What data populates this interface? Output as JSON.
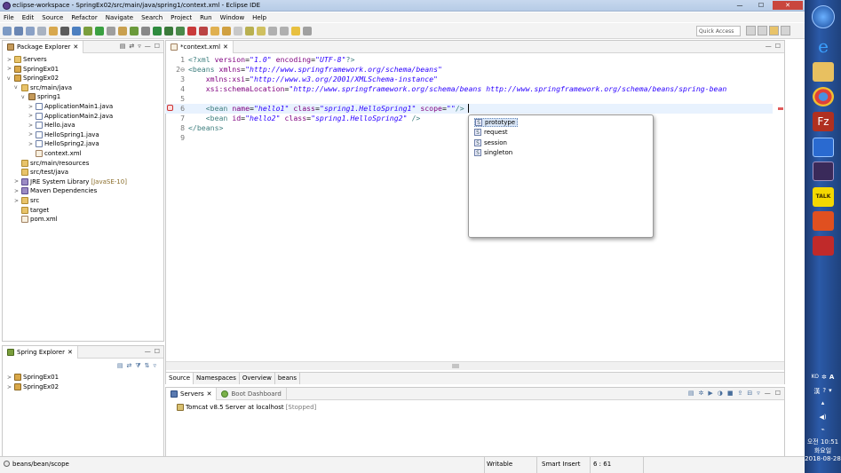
{
  "window": {
    "title": "eclipse-workspace - SpringEx02/src/main/java/spring1/context.xml - Eclipse IDE"
  },
  "menu": [
    "File",
    "Edit",
    "Source",
    "Refactor",
    "Navigate",
    "Search",
    "Project",
    "Run",
    "Window",
    "Help"
  ],
  "toolbar": {
    "quick_access": "Quick Access"
  },
  "package_explorer": {
    "title": "Package Explorer",
    "items": [
      {
        "label": "Servers",
        "icon": "folder",
        "arrow": ">"
      },
      {
        "label": "SpringEx01",
        "icon": "proj",
        "arrow": ">"
      },
      {
        "label": "SpringEx02",
        "icon": "proj",
        "arrow": "v"
      },
      {
        "label": "src/main/java",
        "icon": "folder",
        "arrow": "v"
      },
      {
        "label": "spring1",
        "icon": "pkg",
        "arrow": "v"
      },
      {
        "label": "ApplicationMain1.java",
        "icon": "jfile",
        "arrow": ">"
      },
      {
        "label": "ApplicationMain2.java",
        "icon": "jfile",
        "arrow": ">"
      },
      {
        "label": "Hello.java",
        "icon": "jfile",
        "arrow": ">"
      },
      {
        "label": "HelloSpring1.java",
        "icon": "jfile",
        "arrow": ">"
      },
      {
        "label": "HelloSpring2.java",
        "icon": "jfile",
        "arrow": ">"
      },
      {
        "label": "context.xml",
        "icon": "xfile",
        "arrow": ""
      },
      {
        "label": "src/main/resources",
        "icon": "folder",
        "arrow": ""
      },
      {
        "label": "src/test/java",
        "icon": "folder",
        "arrow": ""
      },
      {
        "label": "JRE System Library",
        "note": "[JavaSE-10]",
        "icon": "lib",
        "arrow": ">"
      },
      {
        "label": "Maven Dependencies",
        "icon": "lib",
        "arrow": ">"
      },
      {
        "label": "src",
        "icon": "folder",
        "arrow": ">"
      },
      {
        "label": "target",
        "icon": "folder",
        "arrow": ""
      },
      {
        "label": "pom.xml",
        "icon": "xfile",
        "arrow": ""
      }
    ]
  },
  "spring_explorer": {
    "title": "Spring Explorer",
    "items": [
      {
        "label": "SpringEx01"
      },
      {
        "label": "SpringEx02"
      }
    ]
  },
  "editor": {
    "tab_label": "*context.xml",
    "lines": [
      {
        "n": "1",
        "html": "<span class=\"pi\">&lt;?xml</span> <span class=\"attr\">version</span>=<span class=\"val\">\"1.0\"</span> <span class=\"attr\">encoding</span>=<span class=\"val\">\"UTF-8\"</span><span class=\"pi\">?&gt;</span>"
      },
      {
        "n": "2⊖",
        "html": "<span class=\"tag\">&lt;beans</span> <span class=\"attr\">xmlns</span>=<span class=\"val\">\"http://www.springframework.org/schema/beans\"</span>"
      },
      {
        "n": "3",
        "html": "    <span class=\"attr\">xmlns:xsi</span>=<span class=\"val\">\"http://www.w3.org/2001/XMLSchema-instance\"</span>"
      },
      {
        "n": "4",
        "html": "    <span class=\"attr\">xsi:schemaLocation</span>=<span class=\"val\">\"http://www.springframework.org/schema/beans http://www.springframework.org/schema/beans/spring-bean</span>"
      },
      {
        "n": "5",
        "html": ""
      },
      {
        "n": "6",
        "html": "    <span class=\"tag\">&lt;bean</span> <span class=\"attr\">name</span>=<span class=\"val\">\"hello1\"</span> <span class=\"attr\">class</span>=<span class=\"val\">\"spring1.HelloSpring1\"</span> <span class=\"attr\">scope</span>=<span class=\"val\">\"\"</span><span class=\"tag\">/&gt;</span>"
      },
      {
        "n": "7",
        "html": "    <span class=\"tag\">&lt;bean</span> <span class=\"attr\">id</span>=<span class=\"val\">\"hello2\"</span> <span class=\"attr\">class</span>=<span class=\"val\">\"spring1.HelloSpring2\"</span> <span class=\"tag\">/&gt;</span>"
      },
      {
        "n": "8",
        "html": "<span class=\"tag\">&lt;/beans&gt;</span>"
      },
      {
        "n": "9",
        "html": ""
      }
    ],
    "bottom_tabs": [
      "Source",
      "Namespaces",
      "Overview",
      "beans"
    ]
  },
  "autocomplete": {
    "items": [
      {
        "label": "prototype",
        "selected": true
      },
      {
        "label": "request",
        "selected": false
      },
      {
        "label": "session",
        "selected": false
      },
      {
        "label": "singleton",
        "selected": false
      }
    ]
  },
  "servers_panel": {
    "tabs": [
      "Servers",
      "Boot Dashboard"
    ],
    "server": "Tomcat v8.5 Server at localhost",
    "status": "[Stopped]"
  },
  "status_bar": {
    "path": "beans/bean/scope",
    "writable": "Writable",
    "insert_mode": "Smart Insert",
    "position": "6 : 61"
  },
  "taskbar": {
    "lang": "KO",
    "ime": "漢",
    "time": "오전 10:51",
    "day": "화요일",
    "date": "2018-08-28"
  }
}
